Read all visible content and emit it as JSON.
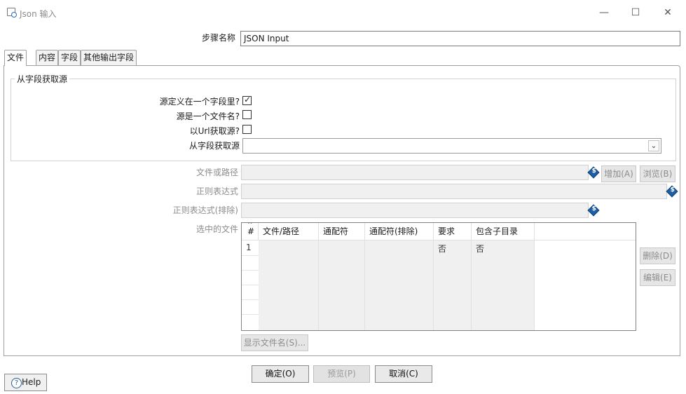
{
  "window": {
    "title": "Json 输入",
    "minimize": "—",
    "maximize": "☐",
    "close": "✕"
  },
  "step": {
    "label": "步骤名称",
    "value": "JSON Input"
  },
  "tabs": [
    {
      "label": "文件"
    },
    {
      "label": "内容"
    },
    {
      "label": "字段"
    },
    {
      "label": "其他输出字段"
    }
  ],
  "source_group": {
    "title": "从字段获取源",
    "defined_in_field_label": "源定义在一个字段里?",
    "defined_in_field_checked": true,
    "is_filename_label": "源是一个文件名?",
    "is_filename_checked": false,
    "from_url_label": "以Url获取源?",
    "from_url_checked": false,
    "get_source_from_field_label": "从字段获取源",
    "get_source_from_field_value": ""
  },
  "file": {
    "path_label": "文件或路径",
    "add_button": "增加(A)",
    "browse_button": "浏览(B)",
    "regex_label": "正则表达式",
    "regex_exclude_label": "正则表达式(排除)",
    "selected_files_label": "选中的文件",
    "delete_button": "删除(D)",
    "edit_button": "编辑(E)",
    "show_filenames_button": "显示文件名(S)..."
  },
  "table": {
    "columns": [
      "#",
      "文件/路径",
      "通配符",
      "通配符(排除)",
      "要求",
      "包含子目录"
    ],
    "rows": [
      {
        "num": "1",
        "path": "",
        "wildcard": "",
        "wildcard_exclude": "",
        "required": "否",
        "include_subdirs": "否"
      }
    ]
  },
  "footer": {
    "ok": "确定(O)",
    "preview": "预览(P)",
    "cancel": "取消(C)",
    "help": "Help"
  }
}
